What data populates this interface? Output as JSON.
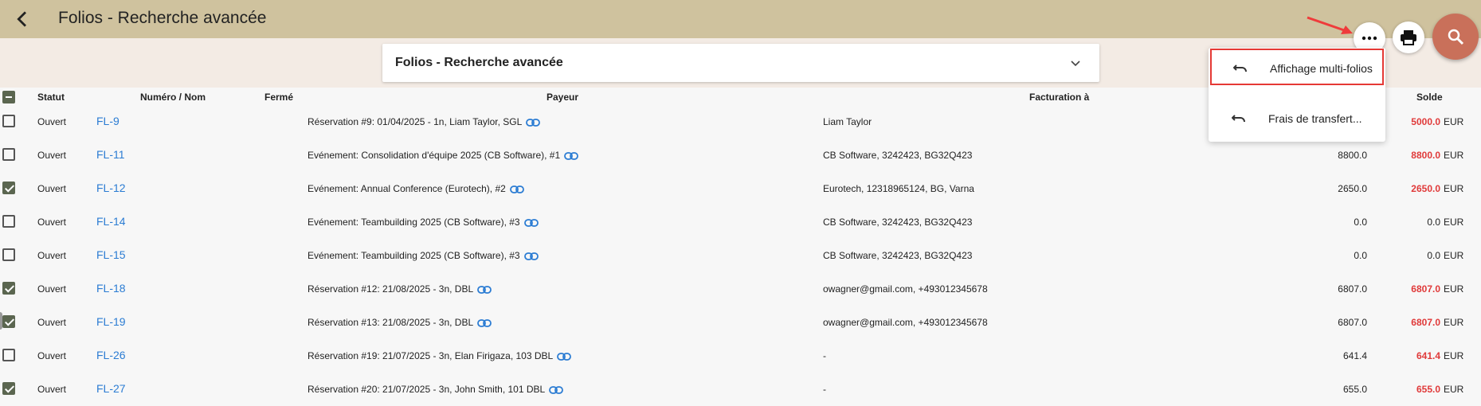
{
  "header": {
    "title": "Folios - Recherche avancée"
  },
  "subheader": {
    "title": "Folios - Recherche avancée"
  },
  "menu": {
    "items": [
      {
        "label": "Affichage multi-folios"
      },
      {
        "label": "Frais de transfert..."
      }
    ]
  },
  "table": {
    "headers": {
      "statut": "Statut",
      "numero": "Numéro / Nom",
      "ferme": "Fermé",
      "payeur": "Payeur",
      "facturation": "Facturation à",
      "solde": "Solde"
    },
    "rows": [
      {
        "checked": false,
        "statut": "Ouvert",
        "numero": "FL-9",
        "payeur": "Réservation #9: 01/04/2025 - 1n, Liam Taylor, SGL",
        "facturation": "Liam Taylor",
        "total": "",
        "solde": "5000.0",
        "solde_red": true,
        "currency": "EUR"
      },
      {
        "checked": false,
        "statut": "Ouvert",
        "numero": "FL-11",
        "payeur": "Evénement: Consolidation d'équipe 2025 (CB Software), #1",
        "facturation": "CB Software, 3242423, BG32Q423",
        "total": "8800.0",
        "solde": "8800.0",
        "solde_red": true,
        "currency": "EUR"
      },
      {
        "checked": true,
        "statut": "Ouvert",
        "numero": "FL-12",
        "payeur": "Evénement: Annual Conference (Eurotech), #2",
        "facturation": "Eurotech, 12318965124, BG, Varna",
        "total": "2650.0",
        "solde": "2650.0",
        "solde_red": true,
        "currency": "EUR"
      },
      {
        "checked": false,
        "statut": "Ouvert",
        "numero": "FL-14",
        "payeur": "Evénement: Teambuilding 2025 (CB Software), #3",
        "facturation": "CB Software, 3242423, BG32Q423",
        "total": "0.0",
        "solde": "0.0",
        "solde_red": false,
        "currency": "EUR"
      },
      {
        "checked": false,
        "statut": "Ouvert",
        "numero": "FL-15",
        "payeur": "Evénement: Teambuilding 2025 (CB Software), #3",
        "facturation": "CB Software, 3242423, BG32Q423",
        "total": "0.0",
        "solde": "0.0",
        "solde_red": false,
        "currency": "EUR"
      },
      {
        "checked": true,
        "statut": "Ouvert",
        "numero": "FL-18",
        "payeur": "Réservation #12: 21/08/2025 - 3n, DBL",
        "facturation": "owagner@gmail.com, +493012345678",
        "total": "6807.0",
        "solde": "6807.0",
        "solde_red": true,
        "currency": "EUR"
      },
      {
        "checked": true,
        "statut": "Ouvert",
        "numero": "FL-19",
        "payeur": "Réservation #13: 21/08/2025 - 3n, DBL",
        "facturation": "owagner@gmail.com, +493012345678",
        "total": "6807.0",
        "solde": "6807.0",
        "solde_red": true,
        "currency": "EUR"
      },
      {
        "checked": false,
        "statut": "Ouvert",
        "numero": "FL-26",
        "payeur": "Réservation #19: 21/07/2025 - 3n, Elan Firigaza, 103 DBL",
        "facturation": "-",
        "total": "641.4",
        "solde": "641.4",
        "solde_red": true,
        "currency": "EUR"
      },
      {
        "checked": true,
        "statut": "Ouvert",
        "numero": "FL-27",
        "payeur": "Réservation #20: 21/07/2025 - 3n, John Smith, 101 DBL",
        "facturation": "-",
        "total": "655.0",
        "solde": "655.0",
        "solde_red": true,
        "currency": "EUR"
      }
    ]
  },
  "colors": {
    "header_bg": "#cfc29e",
    "accent_fab": "#c9705a",
    "link": "#2b7cd3",
    "negative": "#e03a3a",
    "checkbox": "#5b6650",
    "highlight_box": "#e53935"
  },
  "icons": [
    "back-arrow-icon",
    "chevron-down-icon",
    "more-horiz-icon",
    "print-icon",
    "search-icon",
    "link-icon",
    "undo-icon"
  ]
}
